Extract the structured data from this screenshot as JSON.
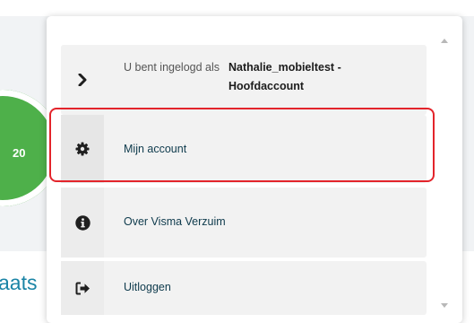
{
  "background": {
    "score": "20",
    "link_fragment": "aats",
    "accent_color": "#4eb04a"
  },
  "menu": {
    "user": {
      "prefix": "U bent ingelogd als",
      "name": "Nathalie_mobieltest - Hoofdaccount",
      "icon": "chevron-right-icon"
    },
    "items": [
      {
        "label": "Mijn account",
        "icon": "gear-icon"
      },
      {
        "label": "Over Visma Verzuim",
        "icon": "info-icon"
      },
      {
        "label": "Uitloggen",
        "icon": "logout-icon"
      }
    ],
    "highlight_color": "#e3242b"
  }
}
